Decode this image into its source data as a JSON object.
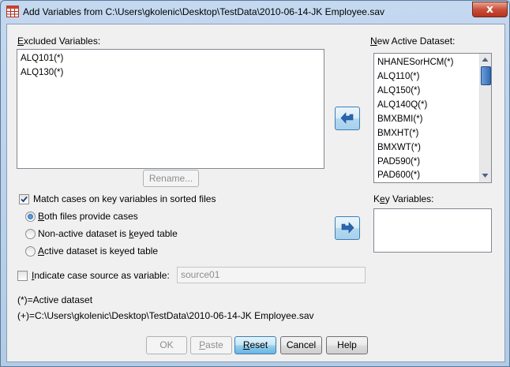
{
  "window": {
    "title": "Add Variables from C:\\Users\\gkolenic\\Desktop\\TestData\\2010-06-14-JK Employee.sav",
    "close_glyph": "x"
  },
  "excluded": {
    "label_first": "E",
    "label_rest": "xcluded Variables:",
    "items": [
      "ALQ101(*)",
      "ALQ130(*)"
    ]
  },
  "rename_button": "Rename...",
  "match": {
    "checked": true,
    "label": "Match cases on key variables in sorted files",
    "options": [
      {
        "pre": "",
        "ul": "B",
        "post": "oth files provide cases",
        "selected": true
      },
      {
        "pre": "Non-active dataset is ",
        "ul": "k",
        "post": "eyed table",
        "selected": false
      },
      {
        "pre": "",
        "ul": "A",
        "post": "ctive dataset is keyed table",
        "selected": false
      }
    ]
  },
  "indicate": {
    "checked": false,
    "pre": "",
    "ul": "I",
    "post": "ndicate case source as variable:",
    "value": "source01"
  },
  "notes": {
    "active": "(*)=Active dataset",
    "file": "(+)=C:\\Users\\gkolenic\\Desktop\\TestData\\2010-06-14-JK Employee.sav"
  },
  "new_active": {
    "label_first": "N",
    "label_rest": "ew Active Dataset:",
    "items": [
      "NHANESorHCM(*)",
      "ALQ110(*)",
      "ALQ150(*)",
      "ALQ140Q(*)",
      "BMXBMI(*)",
      "BMXHT(*)",
      "BMXWT(*)",
      "PAD590(*)",
      "PAD600(*)"
    ]
  },
  "key_vars": {
    "label_pre": "K",
    "label_ul": "e",
    "label_post": "y Variables:"
  },
  "buttons": {
    "ok": "OK",
    "paste_ul": "P",
    "paste_rest": "aste",
    "reset_ul": "R",
    "reset_rest": "eset",
    "cancel": "Cancel",
    "help": "Help"
  },
  "colors": {
    "accent": "#3c7fb1",
    "arrow": "#2a66b0"
  }
}
